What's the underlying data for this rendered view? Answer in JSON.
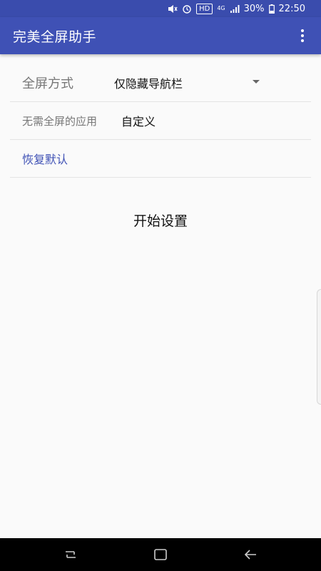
{
  "status": {
    "battery": "30%",
    "time": "22:50",
    "hd_badge": "HD",
    "network": "4G"
  },
  "app_bar": {
    "title": "完美全屏助手",
    "menu_icon": "more-vert-icon"
  },
  "settings": {
    "fullscreen_mode": {
      "label": "全屏方式",
      "value": "仅隐藏导航栏"
    },
    "excluded_apps": {
      "label": "无需全屏的应用",
      "value": "自定义"
    },
    "restore_default": "恢复默认"
  },
  "action": {
    "start_label": "开始设置"
  },
  "colors": {
    "primary": "#3f51b5",
    "status_bar": "#3a4cad",
    "link": "#3f51b5"
  }
}
